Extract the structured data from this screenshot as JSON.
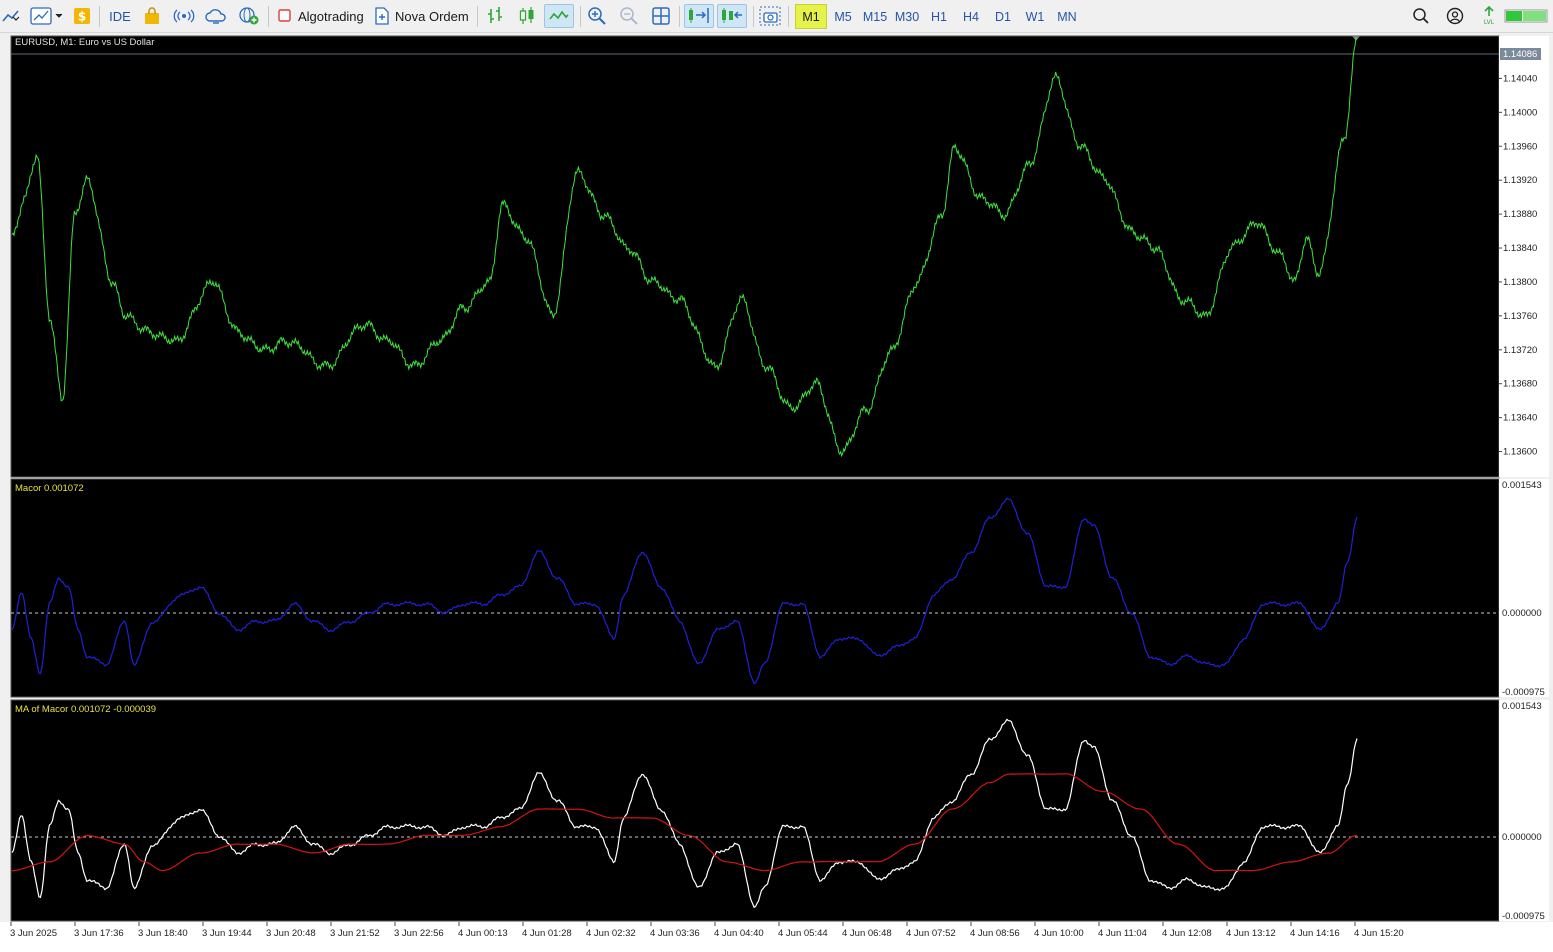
{
  "toolbar": {
    "ide_label": "IDE",
    "algotrading_label": "Algotrading",
    "new_order_label": "Nova Ordem",
    "timeframes": [
      "M1",
      "M5",
      "M15",
      "M30",
      "H1",
      "H4",
      "D1",
      "W1",
      "MN"
    ],
    "active_timeframe": "M1"
  },
  "main_chart": {
    "title": "EURUSD, M1:  Euro vs US Dollar",
    "price_ticks": [
      "1.14040",
      "1.14000",
      "1.13960",
      "1.13920",
      "1.13880",
      "1.13840",
      "1.13800",
      "1.13760",
      "1.13720",
      "1.13680",
      "1.13640",
      "1.13600"
    ],
    "current_price": "1.14086",
    "line_color": "#3fe23f"
  },
  "macor_panel": {
    "label": "Macor 0.001072",
    "ticks": [
      "0.001543",
      "0.000000",
      "-0.000975"
    ],
    "line_color": "#2020d8"
  },
  "ma_panel": {
    "label": "MA of Macor 0.001072 -0.000039",
    "ticks": [
      "0.001543",
      "0.000000",
      "-0.000975"
    ],
    "macor_color": "#ffffff",
    "ma_color": "#d21414"
  },
  "time_axis": [
    "3 Jun 2025",
    "3 Jun 17:36",
    "3 Jun 18:40",
    "3 Jun 19:44",
    "3 Jun 20:48",
    "3 Jun 21:52",
    "3 Jun 22:56",
    "4 Jun 00:13",
    "4 Jun 01:28",
    "4 Jun 02:32",
    "4 Jun 03:36",
    "4 Jun 04:40",
    "4 Jun 05:44",
    "4 Jun 06:48",
    "4 Jun 07:52",
    "4 Jun 08:56",
    "4 Jun 10:00",
    "4 Jun 11:04",
    "4 Jun 12:08",
    "4 Jun 13:12",
    "4 Jun 14:16",
    "4 Jun 15:20"
  ],
  "chart_data": {
    "type": "line",
    "title": "EURUSD, M1:  Euro vs US Dollar",
    "x": [
      "3 Jun 2025",
      "3 Jun 17:36",
      "3 Jun 18:40",
      "3 Jun 19:44",
      "3 Jun 20:48",
      "3 Jun 21:52",
      "3 Jun 22:56",
      "4 Jun 00:13",
      "4 Jun 01:28",
      "4 Jun 02:32",
      "4 Jun 03:36",
      "4 Jun 04:40",
      "4 Jun 05:44",
      "4 Jun 06:48",
      "4 Jun 07:52",
      "4 Jun 08:56",
      "4 Jun 10:00",
      "4 Jun 11:04",
      "4 Jun 12:08",
      "4 Jun 13:12",
      "4 Jun 14:16",
      "4 Jun 15:20"
    ],
    "price_ylim": [
      1.1357,
      1.1409
    ],
    "price_anchors": [
      [
        0,
        1.1385
      ],
      [
        1,
        1.139
      ],
      [
        2,
        1.1395
      ],
      [
        3,
        1.1376
      ],
      [
        4,
        1.1366
      ],
      [
        5,
        1.1388
      ],
      [
        6,
        1.1392
      ],
      [
        8,
        1.138
      ],
      [
        9,
        1.1376
      ],
      [
        11,
        1.1374
      ],
      [
        13,
        1.1373
      ],
      [
        16,
        1.138
      ],
      [
        18,
        1.1374
      ],
      [
        20,
        1.1372
      ],
      [
        22,
        1.1373
      ],
      [
        25,
        1.137
      ],
      [
        28,
        1.1375
      ],
      [
        30,
        1.1373
      ],
      [
        32,
        1.137
      ],
      [
        34,
        1.1373
      ],
      [
        36,
        1.1377
      ],
      [
        38,
        1.138
      ],
      [
        39,
        1.1389
      ],
      [
        41,
        1.1385
      ],
      [
        43,
        1.1376
      ],
      [
        45,
        1.1393
      ],
      [
        47,
        1.1388
      ],
      [
        49,
        1.1384
      ],
      [
        51,
        1.138
      ],
      [
        53,
        1.1378
      ],
      [
        56,
        1.137
      ],
      [
        58,
        1.1378
      ],
      [
        60,
        1.137
      ],
      [
        62,
        1.1365
      ],
      [
        64,
        1.1368
      ],
      [
        66,
        1.136
      ],
      [
        68,
        1.1365
      ],
      [
        70,
        1.1372
      ],
      [
        72,
        1.138
      ],
      [
        74,
        1.1388
      ],
      [
        75,
        1.1396
      ],
      [
        77,
        1.139
      ],
      [
        79,
        1.1388
      ],
      [
        81,
        1.1394
      ],
      [
        83,
        1.1404
      ],
      [
        85,
        1.1396
      ],
      [
        87,
        1.1392
      ],
      [
        89,
        1.1386
      ],
      [
        91,
        1.1384
      ],
      [
        93,
        1.1378
      ],
      [
        95,
        1.1376
      ],
      [
        97,
        1.1384
      ],
      [
        99,
        1.1387
      ],
      [
        101,
        1.1383
      ],
      [
        102,
        1.138
      ],
      [
        103,
        1.1385
      ],
      [
        104,
        1.1381
      ],
      [
        106,
        1.1397
      ],
      [
        107,
        1.14086
      ]
    ],
    "macor_ylim": [
      -0.000975,
      0.001543
    ],
    "macor_anchors": [
      [
        0,
        -0.0002
      ],
      [
        1,
        0.00025
      ],
      [
        2,
        -0.0003
      ],
      [
        3,
        -0.0007
      ],
      [
        4,
        0.0001
      ],
      [
        5,
        0.0004
      ],
      [
        6,
        0.0003
      ],
      [
        7,
        -0.0002
      ],
      [
        8,
        -0.0005
      ],
      [
        10,
        -0.0006
      ],
      [
        12,
        -0.0001
      ],
      [
        13,
        -0.0006
      ],
      [
        15,
        -0.0001
      ],
      [
        18,
        0.0002
      ],
      [
        20,
        0.0003
      ],
      [
        22,
        0.0
      ],
      [
        24,
        -0.0002
      ],
      [
        26,
        -0.0001
      ],
      [
        28,
        -0.0001
      ],
      [
        30,
        0.0001
      ],
      [
        32,
        -0.0001
      ],
      [
        34,
        -0.0002
      ],
      [
        36,
        -0.0001
      ],
      [
        38,
        0.0
      ],
      [
        40,
        0.0001
      ],
      [
        42,
        0.0001
      ],
      [
        44,
        0.0001
      ],
      [
        46,
        0.0
      ],
      [
        48,
        0.0001
      ],
      [
        50,
        0.0001
      ],
      [
        52,
        0.0002
      ],
      [
        54,
        0.0003
      ],
      [
        56,
        0.0007
      ],
      [
        58,
        0.0004
      ],
      [
        60,
        0.0001
      ],
      [
        62,
        0.0001
      ],
      [
        64,
        -0.0003
      ],
      [
        65,
        0.0002
      ],
      [
        67,
        0.0007
      ],
      [
        69,
        0.0003
      ],
      [
        71,
        -0.0001
      ],
      [
        73,
        -0.0006
      ],
      [
        75,
        -0.0002
      ],
      [
        77,
        -0.0001
      ],
      [
        79,
        -0.0008
      ],
      [
        80,
        -0.0006
      ],
      [
        82,
        0.0001
      ],
      [
        84,
        0.0001
      ],
      [
        86,
        -0.0005
      ],
      [
        88,
        -0.0003
      ],
      [
        90,
        -0.0003
      ],
      [
        92,
        -0.0005
      ],
      [
        94,
        -0.0004
      ],
      [
        96,
        -0.0003
      ],
      [
        98,
        0.0002
      ],
      [
        100,
        0.0004
      ],
      [
        102,
        0.0007
      ],
      [
        104,
        0.0011
      ],
      [
        106,
        0.0013
      ],
      [
        108,
        0.0009
      ],
      [
        110,
        0.0003
      ],
      [
        112,
        0.0003
      ],
      [
        114,
        0.0011
      ],
      [
        115,
        0.001
      ],
      [
        117,
        0.0004
      ],
      [
        119,
        0.0
      ],
      [
        121,
        -0.0005
      ],
      [
        123,
        -0.0006
      ],
      [
        125,
        -0.0005
      ],
      [
        127,
        -0.0006
      ],
      [
        129,
        -0.0006
      ],
      [
        131,
        -0.0003
      ],
      [
        133,
        0.0001
      ],
      [
        135,
        0.0001
      ],
      [
        137,
        0.0001
      ],
      [
        139,
        -0.0002
      ],
      [
        141,
        0.0001
      ],
      [
        142,
        0.0006
      ],
      [
        143,
        0.0011
      ]
    ],
    "ma_anchors": [
      [
        0,
        -0.0004
      ],
      [
        4,
        -0.0003
      ],
      [
        8,
        0.0
      ],
      [
        12,
        -0.0001
      ],
      [
        14,
        -0.0003
      ],
      [
        16,
        -0.0004
      ],
      [
        20,
        -0.0002
      ],
      [
        24,
        -0.0001
      ],
      [
        28,
        -0.0001
      ],
      [
        32,
        -0.0002
      ],
      [
        36,
        -0.0001
      ],
      [
        40,
        -0.0001
      ],
      [
        44,
        0.0
      ],
      [
        48,
        0.0
      ],
      [
        52,
        0.0001
      ],
      [
        56,
        0.0003
      ],
      [
        60,
        0.0003
      ],
      [
        64,
        0.0002
      ],
      [
        68,
        0.0002
      ],
      [
        72,
        0.0
      ],
      [
        76,
        -0.0003
      ],
      [
        80,
        -0.0004
      ],
      [
        84,
        -0.0003
      ],
      [
        88,
        -0.0003
      ],
      [
        92,
        -0.0003
      ],
      [
        96,
        -0.0001
      ],
      [
        100,
        0.0003
      ],
      [
        104,
        0.0006
      ],
      [
        106,
        0.0007
      ],
      [
        108,
        0.0007
      ],
      [
        112,
        0.0007
      ],
      [
        116,
        0.0005
      ],
      [
        120,
        0.0003
      ],
      [
        124,
        -0.0001
      ],
      [
        128,
        -0.0004
      ],
      [
        132,
        -0.0004
      ],
      [
        136,
        -0.0003
      ],
      [
        140,
        -0.0002
      ],
      [
        143,
        0.0
      ]
    ]
  }
}
